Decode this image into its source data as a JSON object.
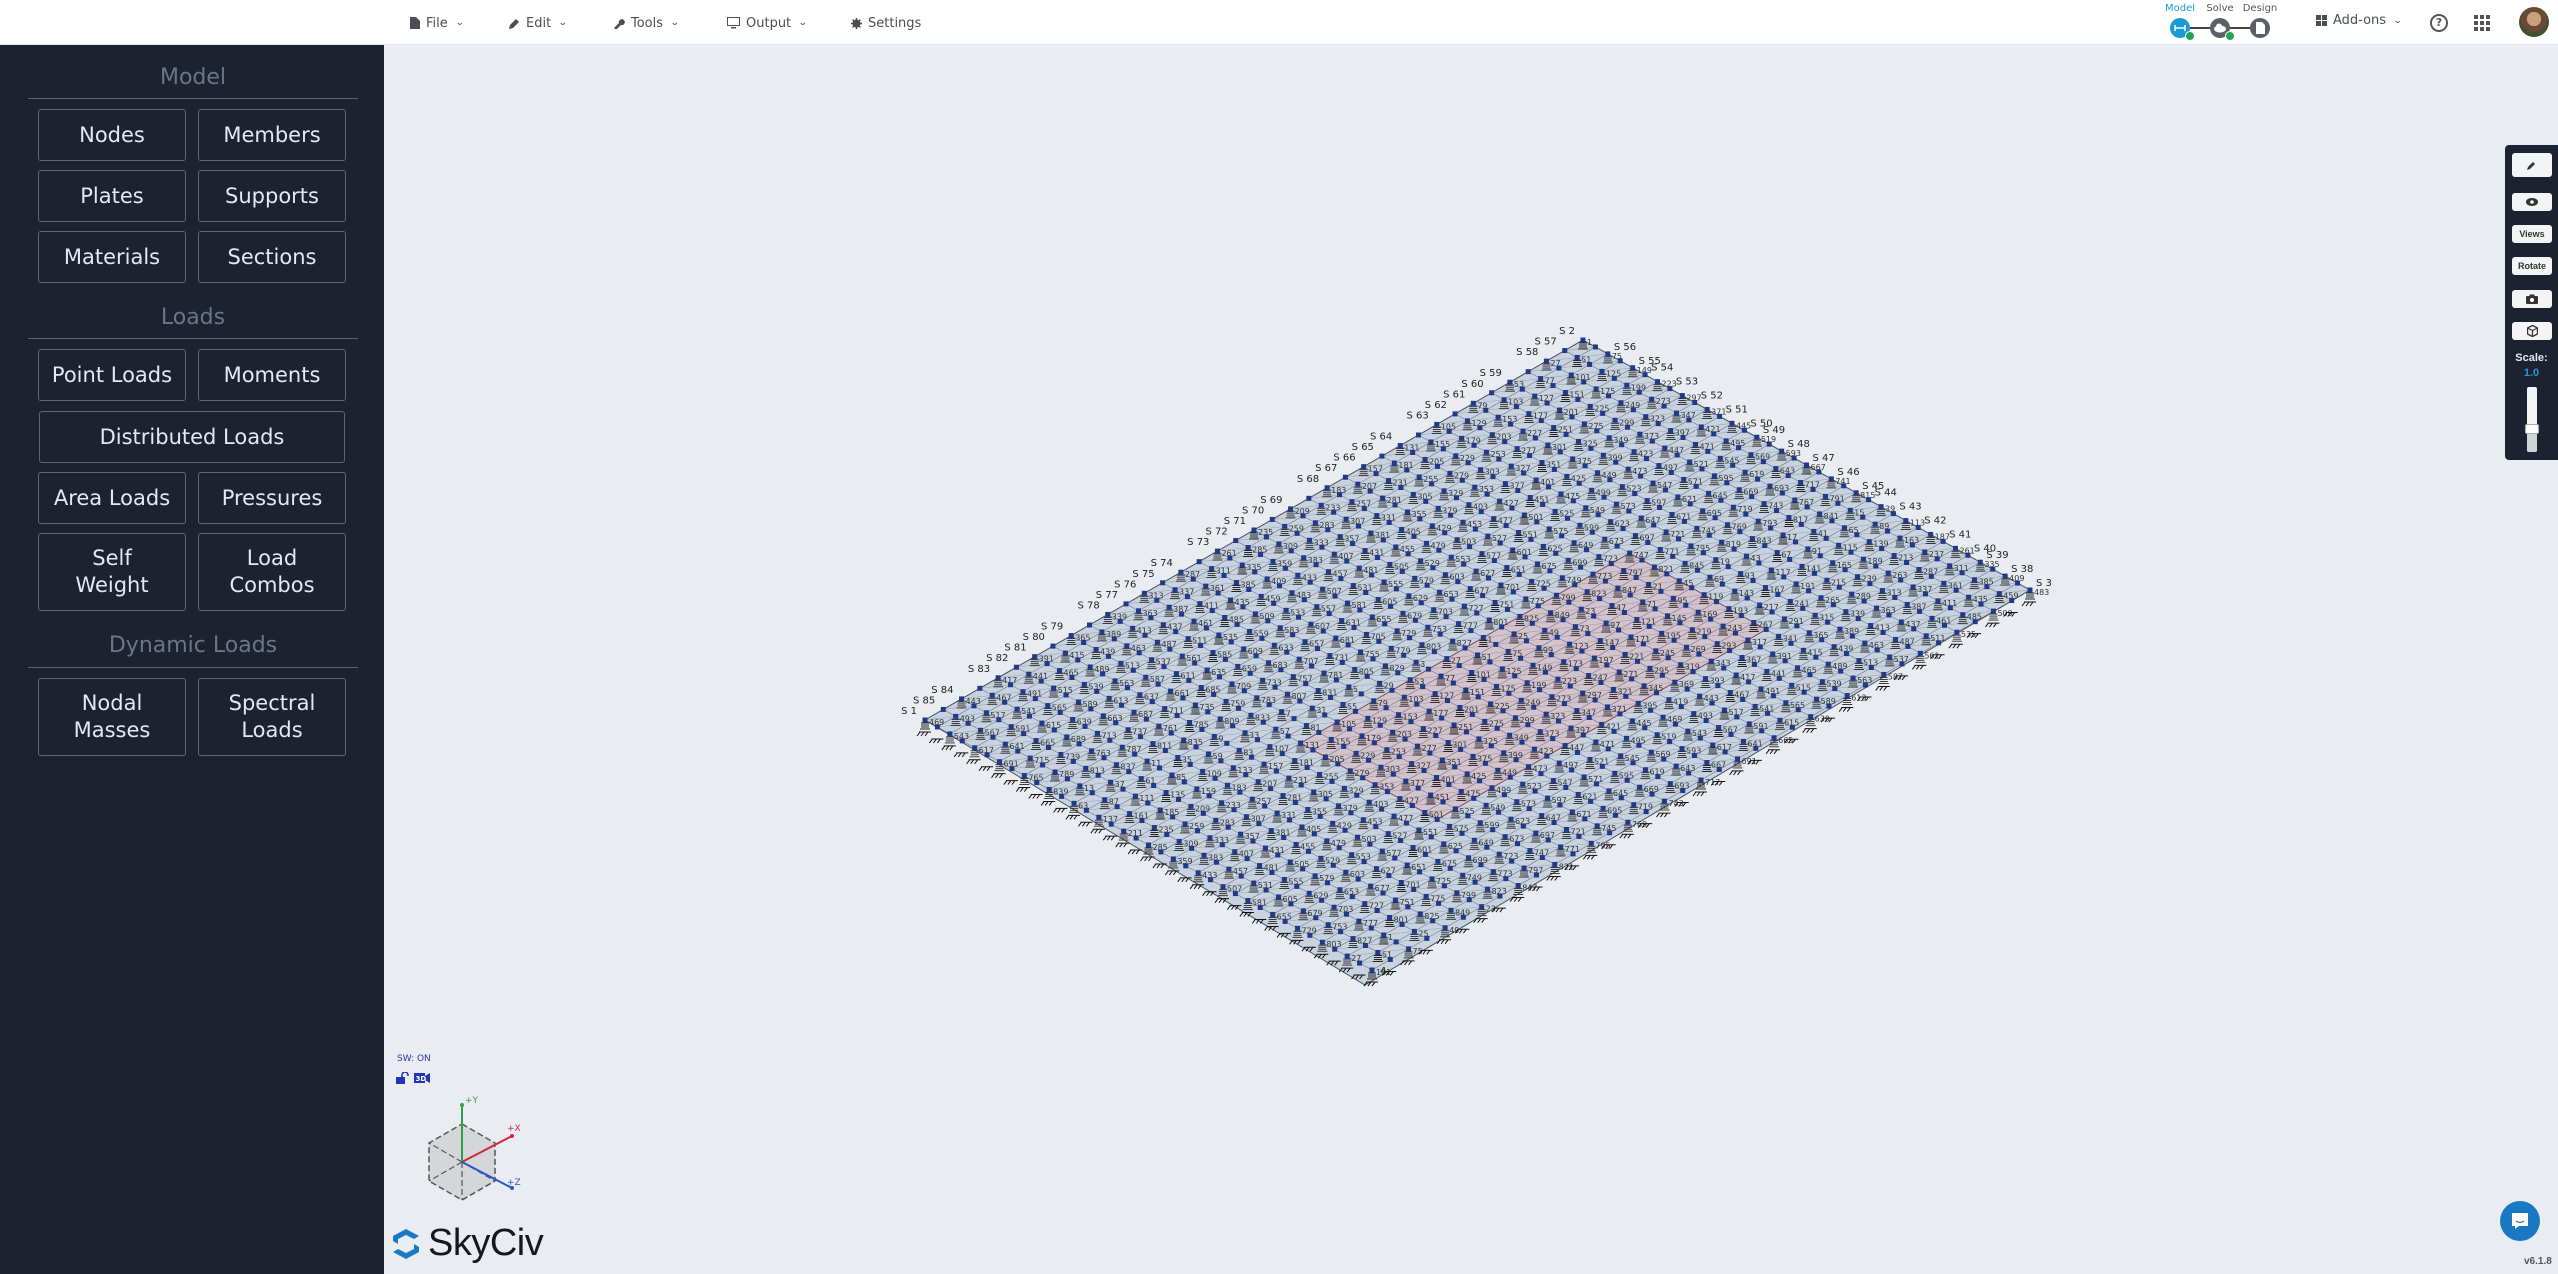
{
  "topbar": {
    "menu": [
      {
        "label": "File",
        "icon": "file-icon",
        "dropdown": true
      },
      {
        "label": "Edit",
        "icon": "pencil-icon",
        "dropdown": true
      },
      {
        "label": "Tools",
        "icon": "wrench-icon",
        "dropdown": true
      },
      {
        "label": "Output",
        "icon": "monitor-icon",
        "dropdown": true
      },
      {
        "label": "Settings",
        "icon": "gear-icon",
        "dropdown": false
      }
    ],
    "workflow": {
      "steps": [
        {
          "label": "Model",
          "icon": "beam-icon",
          "active": true,
          "complete": true
        },
        {
          "label": "Solve",
          "icon": "cloud-icon",
          "active": false,
          "complete": true
        },
        {
          "label": "Design",
          "icon": "document-icon",
          "active": false,
          "complete": false
        }
      ]
    },
    "addons_label": "Add-ons",
    "help_label": "?",
    "colors": {
      "accent": "#1a9ad6",
      "check": "#23a455"
    }
  },
  "sidebar": {
    "sections": [
      {
        "title": "Model",
        "buttons": [
          "Nodes",
          "Members",
          "Plates",
          "Supports",
          "Materials",
          "Sections"
        ]
      },
      {
        "title": "Loads",
        "buttons": [
          "Point Loads",
          "Moments",
          "Distributed Loads",
          "Area Loads",
          "Pressures",
          "Self\nWeight",
          "Load\nCombos"
        ]
      },
      {
        "title": "Dynamic Loads",
        "buttons": [
          "Nodal\nMasses",
          "Spectral\nLoads"
        ]
      }
    ]
  },
  "right_toolbar": {
    "buttons": [
      {
        "name": "edit",
        "icon": "pencil-icon",
        "label": ""
      },
      {
        "name": "visibility",
        "icon": "eye-icon",
        "label": ""
      },
      {
        "name": "views",
        "icon": "",
        "label": "Views"
      },
      {
        "name": "rotate",
        "icon": "",
        "label": "Rotate"
      },
      {
        "name": "screenshot",
        "icon": "camera-icon",
        "label": ""
      },
      {
        "name": "3d-render",
        "icon": "cube-icon",
        "label": ""
      }
    ],
    "scale_label": "Scale:",
    "scale_value": "1.0",
    "scale_slider_fraction": 0.35
  },
  "viewport": {
    "sw_status": "SW: ON",
    "axes": {
      "y": "+Y",
      "x": "+X",
      "z": "+Z"
    },
    "mesh": {
      "divisions_per_edge": 36,
      "support_type": "spring",
      "top_edge_labels": [
        "S 2",
        "S 57",
        "S 58",
        "S 59",
        "S 60",
        "S 61",
        "S 62",
        "S 63",
        "S 64",
        "S 65",
        "S 66",
        "S 67",
        "S 68",
        "S 69",
        "S 70",
        "S 71",
        "S 72",
        "S 73",
        "S 74",
        "S 75",
        "S 76",
        "S 77",
        "S 78",
        "S 79",
        "S 80",
        "S 81",
        "S 82",
        "S 83",
        "S 84",
        "S 85",
        "S 1"
      ],
      "right_edge_labels": [
        "S 56",
        "S 55",
        "S 54",
        "S 53",
        "S 52",
        "S 51",
        "S 50",
        "S 49",
        "S 48",
        "S 47",
        "S 46",
        "S 45",
        "S 44",
        "S 43",
        "S 42",
        "S 41",
        "S 40",
        "S 39",
        "S 38",
        "S 3"
      ],
      "bottom_corner_label": "4",
      "colors": {
        "node": "#1f3a8a",
        "plate": "#c9d3e0",
        "highlight_plate": "#d9b9bf",
        "line": "#4a5060",
        "highlight_line": "#b04a55"
      }
    }
  },
  "branding": {
    "logo_text": "SkyCiv",
    "version": "v6.1.8"
  }
}
